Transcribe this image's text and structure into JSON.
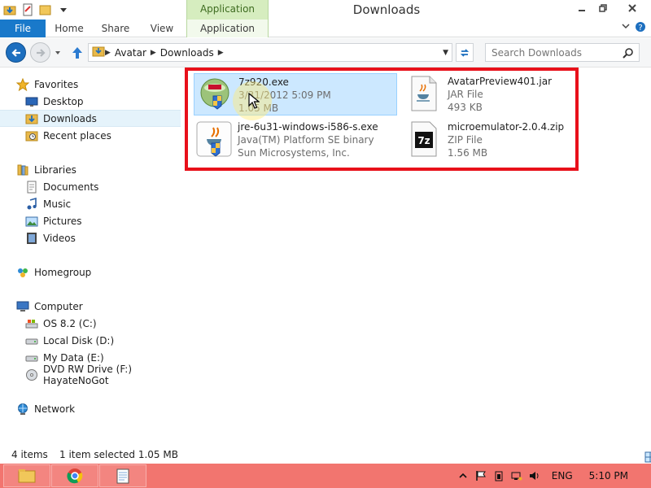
{
  "window": {
    "title": "Downloads",
    "contextual_tab_group": "Application Tools",
    "controls": [
      "minimize",
      "restore",
      "close"
    ]
  },
  "ribbon": {
    "tabs": [
      {
        "label": "File"
      },
      {
        "label": "Home"
      },
      {
        "label": "Share"
      },
      {
        "label": "View"
      },
      {
        "label": "Application"
      }
    ]
  },
  "address": {
    "breadcrumbs": [
      "Avatar",
      "Downloads"
    ],
    "search_placeholder": "Search Downloads"
  },
  "sidebar": {
    "favorites": {
      "label": "Favorites",
      "items": [
        {
          "label": "Desktop",
          "icon": "desktop-icon"
        },
        {
          "label": "Downloads",
          "icon": "downloads-folder-icon",
          "selected": true
        },
        {
          "label": "Recent places",
          "icon": "recent-places-icon"
        }
      ]
    },
    "libraries": {
      "label": "Libraries",
      "items": [
        {
          "label": "Documents",
          "icon": "documents-icon"
        },
        {
          "label": "Music",
          "icon": "music-icon"
        },
        {
          "label": "Pictures",
          "icon": "pictures-icon"
        },
        {
          "label": "Videos",
          "icon": "videos-icon"
        }
      ]
    },
    "homegroup": {
      "label": "Homegroup"
    },
    "computer": {
      "label": "Computer",
      "items": [
        {
          "label": "OS 8.2 (C:)",
          "icon": "system-drive-icon"
        },
        {
          "label": "Local Disk (D:)",
          "icon": "hard-drive-icon"
        },
        {
          "label": "My Data (E:)",
          "icon": "hard-drive-icon"
        },
        {
          "label": "DVD RW Drive (F:) HayateNoGot",
          "icon": "dvd-drive-icon"
        }
      ]
    },
    "network": {
      "label": "Network"
    }
  },
  "files": [
    {
      "name": "7z920.exe",
      "line2": "3/31/2012 5:09 PM",
      "line3": "1.05 MB",
      "icon": "installer-icon",
      "selected": true
    },
    {
      "name": "AvatarPreview401.jar",
      "line2": "JAR File",
      "line3": "493 KB",
      "icon": "jar-file-icon",
      "selected": false
    },
    {
      "name": "jre-6u31-windows-i586-s.exe",
      "line2": "Java(TM) Platform SE binary",
      "line3": "Sun Microsystems, Inc.",
      "icon": "java-installer-icon",
      "selected": false
    },
    {
      "name": "microemulator-2.0.4.zip",
      "line2": "ZIP File",
      "line3": "1.56 MB",
      "icon": "7z-archive-icon",
      "selected": false
    }
  ],
  "status": {
    "item_count": "4 items",
    "selection": "1 item selected  1.05 MB"
  },
  "taskbar": {
    "buttons": [
      "file-explorer-icon",
      "chrome-icon",
      "notepad-icon"
    ],
    "language": "ENG",
    "time": "5:10 PM"
  },
  "colors": {
    "accent": "#1979ca",
    "selection": "#cce8ff",
    "highlight_box": "#e8101a",
    "taskbar": "#f2756f",
    "app_tools": "#d6edbf"
  }
}
